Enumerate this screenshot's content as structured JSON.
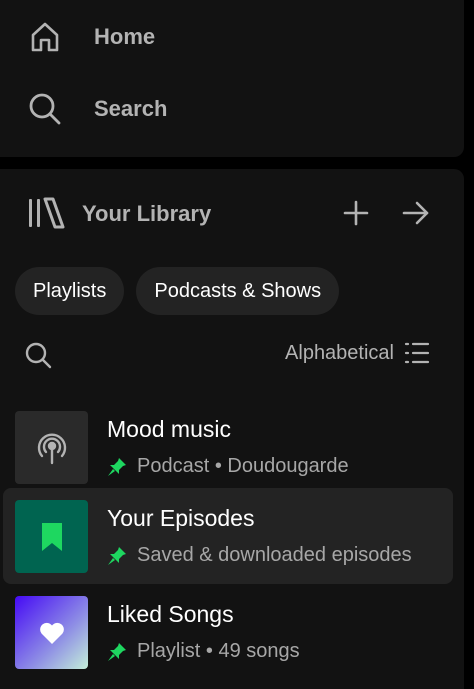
{
  "nav": {
    "home_label": "Home",
    "search_label": "Search"
  },
  "library": {
    "title": "Your Library",
    "chips": [
      "Playlists",
      "Podcasts & Shows"
    ],
    "sort_label": "Alphabetical",
    "items": [
      {
        "title": "Mood music",
        "subtitle": "Podcast • Doudougarde",
        "pinned": true,
        "thumb_icon": "podcast-icon"
      },
      {
        "title": "Your Episodes",
        "subtitle": "Saved & downloaded episodes",
        "pinned": true,
        "thumb_icon": "bookmark-icon"
      },
      {
        "title": "Liked Songs",
        "subtitle": "Playlist • 49 songs",
        "pinned": true,
        "thumb_icon": "heart-icon"
      }
    ]
  },
  "colors": {
    "accent": "#1ed760",
    "background": "#121212",
    "episodes_tile": "#006450",
    "text_muted": "#b3b3b3"
  }
}
